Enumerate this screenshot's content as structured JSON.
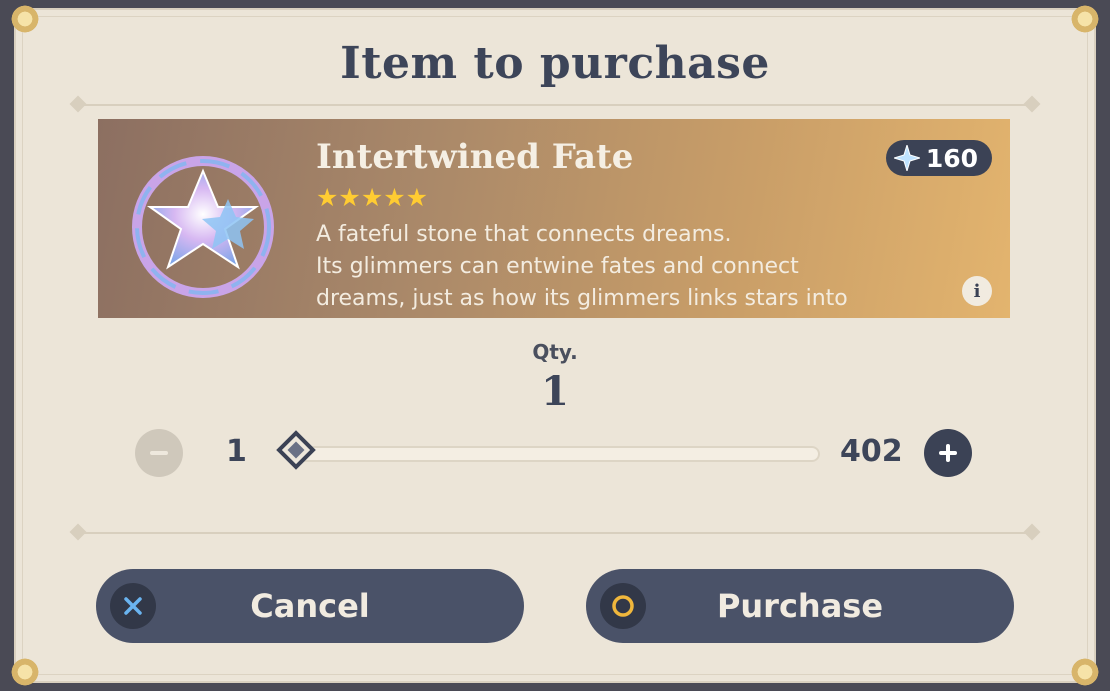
{
  "dialog": {
    "title": "Item to purchase"
  },
  "item": {
    "name": "Intertwined Fate",
    "rarity": 5,
    "stars": "★★★★★",
    "description": [
      "A fateful stone that connects dreams.",
      "Its glimmers can entwine fates and connect",
      "dreams, just as how its glimmers links stars into"
    ],
    "price": "160",
    "currency_icon": "primogem-icon",
    "info_icon": "info-icon"
  },
  "quantity": {
    "label": "Qty.",
    "value": "1",
    "min": "1",
    "max": "402",
    "slider_fraction": 0
  },
  "actions": {
    "cancel_label": "Cancel",
    "purchase_label": "Purchase"
  },
  "colors": {
    "accent": "#3b4255",
    "panel": "#ece5d8",
    "star": "#ffcc32",
    "cancel_icon": "#6ab4f0",
    "purchase_icon": "#f0b73c"
  }
}
